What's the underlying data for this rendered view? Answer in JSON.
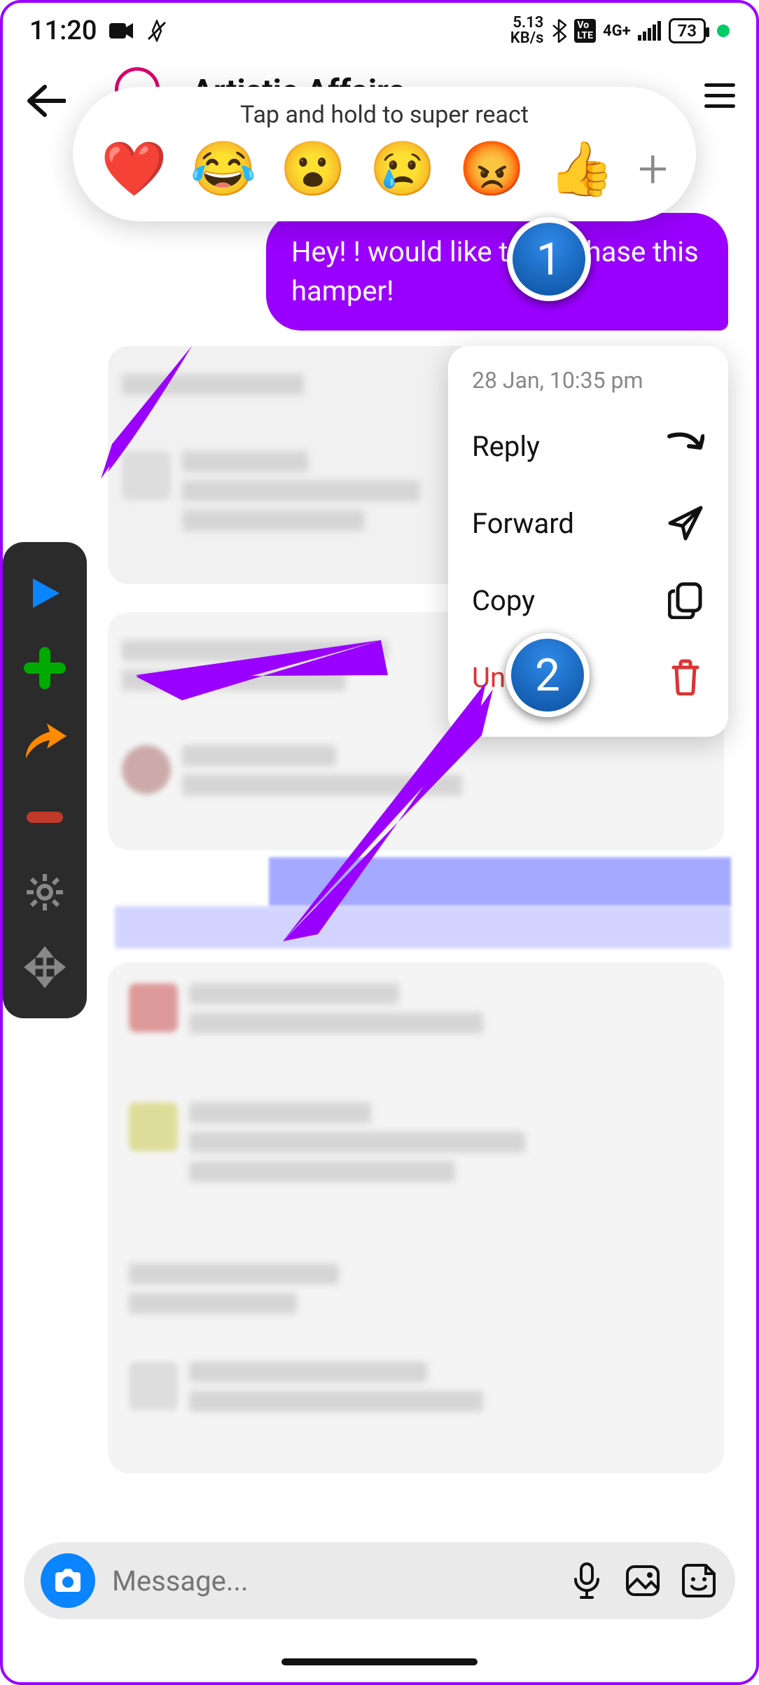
{
  "status": {
    "time": "11:20",
    "net_speed_top": "5.13",
    "net_speed_bottom": "KB/s",
    "volte": "Vo LTE",
    "signal": "4G+",
    "battery": "73"
  },
  "chat": {
    "title_partial": "Artistic Affairs"
  },
  "reaction_bar": {
    "hint": "Tap and hold to super react",
    "emojis": [
      "❤️",
      "😂",
      "😮",
      "😢",
      "😡",
      "👍"
    ],
    "more": "+"
  },
  "sent_message": {
    "text": "Hey! ! would like to purchase this hamper!"
  },
  "context_menu": {
    "timestamp": "28 Jan, 10:35 pm",
    "reply": "Reply",
    "forward": "Forward",
    "copy": "Copy",
    "unsend": "Unsend"
  },
  "composer": {
    "placeholder": "Message..."
  },
  "annotations": {
    "badge1": "1",
    "badge2": "2"
  },
  "icons": {
    "back": "back-arrow-icon",
    "menu": "hamburger-icon",
    "reply": "reply-arrow-icon",
    "forward": "send-plane-icon",
    "copy": "copy-icon",
    "unsend": "trash-icon",
    "camera": "camera-icon",
    "mic": "mic-icon",
    "image": "image-icon",
    "sticker": "sticker-icon",
    "dock_play": "play-icon",
    "dock_plus": "plus-icon",
    "dock_share": "share-arrow-icon",
    "dock_minus": "minus-icon",
    "dock_gear": "gear-icon",
    "dock_move": "move-icon"
  }
}
